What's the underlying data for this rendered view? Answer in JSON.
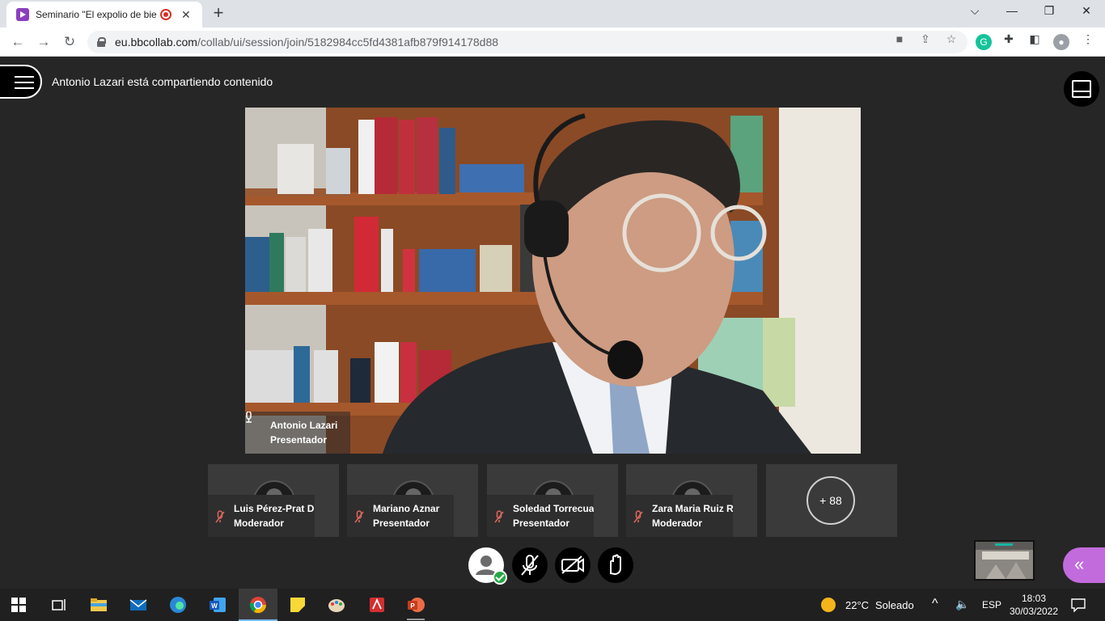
{
  "browser": {
    "tab_title": "Seminario \"El expolio de bienes",
    "tab_close": "✕",
    "new_tab": "+",
    "url_host": "eu.bbcollab.com",
    "url_path": "/collab/ui/session/join/5182984cc5fd4381afb879f914178d88",
    "window_controls": {
      "minimize": "⌵",
      "restore": "—",
      "maximize": "❐",
      "close": "✕"
    }
  },
  "session": {
    "sharing_message": "Antonio Lazari está compartiendo contenido"
  },
  "main_video": {
    "name": "Antonio Lazari",
    "role": "Presentador"
  },
  "participants": [
    {
      "name": "Luis Pérez-Prat D...",
      "role": "Moderador"
    },
    {
      "name": "Mariano Aznar",
      "role": "Presentador"
    },
    {
      "name": "Soledad Torrecua...",
      "role": "Presentador"
    },
    {
      "name": "Zara Maria Ruiz R...",
      "role": "Moderador"
    }
  ],
  "more_participants": "+ 88",
  "colors": {
    "accent_panel": "#c26bdd",
    "status_ok": "#27a844",
    "mute_red": "#e0685f"
  },
  "taskbar": {
    "temperature": "22°C",
    "weather": "Soleado",
    "language": "ESP",
    "time": "18:03",
    "date": "30/03/2022"
  }
}
